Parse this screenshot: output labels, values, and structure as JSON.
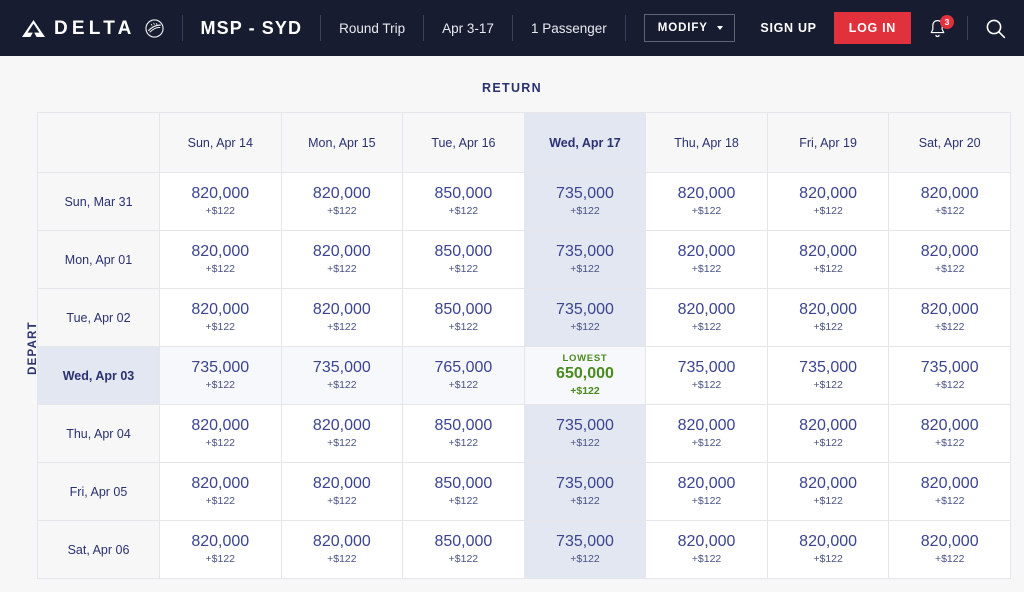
{
  "header": {
    "brand": "DELTA",
    "widget_icon": "delta-widget-icon",
    "skymiles_icon": "skymiles-emblem-icon",
    "route": "MSP - SYD",
    "trip_type": "Round Trip",
    "date_range": "Apr 3-17",
    "passengers": "1 Passenger",
    "modify_label": "MODIFY",
    "sign_up": "SIGN UP",
    "log_in": "LOG IN",
    "notification_count": "3",
    "bell_icon": "bell-icon",
    "search_icon": "search-icon",
    "accent_red": "#e0313d",
    "bar_background": "#171c30"
  },
  "calendar": {
    "return_label": "RETURN",
    "depart_label": "DEPART",
    "selected_return_column": "Wed, Apr 17",
    "selected_depart_row": "Wed, Apr 03",
    "lowest_tag": "LOWEST",
    "highlight_color": "#e3e7f2",
    "lowest_color": "#4a8b1f",
    "miles_color": "#3b4490",
    "return_dates": [
      "Sun, Apr 14",
      "Mon, Apr 15",
      "Tue, Apr 16",
      "Wed, Apr 17",
      "Thu, Apr 18",
      "Fri, Apr 19",
      "Sat, Apr 20"
    ],
    "depart_dates": [
      "Sun, Mar 31",
      "Mon, Apr 01",
      "Tue, Apr 02",
      "Wed, Apr 03",
      "Thu, Apr 04",
      "Fri, Apr 05",
      "Sat, Apr 06"
    ],
    "rows": [
      {
        "depart": "Sun, Mar 31",
        "selected": false,
        "cells": [
          {
            "miles": "820,000",
            "taxes": "+$122",
            "lowest": false
          },
          {
            "miles": "820,000",
            "taxes": "+$122",
            "lowest": false
          },
          {
            "miles": "850,000",
            "taxes": "+$122",
            "lowest": false
          },
          {
            "miles": "735,000",
            "taxes": "+$122",
            "lowest": false
          },
          {
            "miles": "820,000",
            "taxes": "+$122",
            "lowest": false
          },
          {
            "miles": "820,000",
            "taxes": "+$122",
            "lowest": false
          },
          {
            "miles": "820,000",
            "taxes": "+$122",
            "lowest": false
          }
        ]
      },
      {
        "depart": "Mon, Apr 01",
        "selected": false,
        "cells": [
          {
            "miles": "820,000",
            "taxes": "+$122",
            "lowest": false
          },
          {
            "miles": "820,000",
            "taxes": "+$122",
            "lowest": false
          },
          {
            "miles": "850,000",
            "taxes": "+$122",
            "lowest": false
          },
          {
            "miles": "735,000",
            "taxes": "+$122",
            "lowest": false
          },
          {
            "miles": "820,000",
            "taxes": "+$122",
            "lowest": false
          },
          {
            "miles": "820,000",
            "taxes": "+$122",
            "lowest": false
          },
          {
            "miles": "820,000",
            "taxes": "+$122",
            "lowest": false
          }
        ]
      },
      {
        "depart": "Tue, Apr 02",
        "selected": false,
        "cells": [
          {
            "miles": "820,000",
            "taxes": "+$122",
            "lowest": false
          },
          {
            "miles": "820,000",
            "taxes": "+$122",
            "lowest": false
          },
          {
            "miles": "850,000",
            "taxes": "+$122",
            "lowest": false
          },
          {
            "miles": "735,000",
            "taxes": "+$122",
            "lowest": false
          },
          {
            "miles": "820,000",
            "taxes": "+$122",
            "lowest": false
          },
          {
            "miles": "820,000",
            "taxes": "+$122",
            "lowest": false
          },
          {
            "miles": "820,000",
            "taxes": "+$122",
            "lowest": false
          }
        ]
      },
      {
        "depart": "Wed, Apr 03",
        "selected": true,
        "cells": [
          {
            "miles": "735,000",
            "taxes": "+$122",
            "lowest": false
          },
          {
            "miles": "735,000",
            "taxes": "+$122",
            "lowest": false
          },
          {
            "miles": "765,000",
            "taxes": "+$122",
            "lowest": false
          },
          {
            "miles": "650,000",
            "taxes": "+$122",
            "lowest": true
          },
          {
            "miles": "735,000",
            "taxes": "+$122",
            "lowest": false
          },
          {
            "miles": "735,000",
            "taxes": "+$122",
            "lowest": false
          },
          {
            "miles": "735,000",
            "taxes": "+$122",
            "lowest": false
          }
        ]
      },
      {
        "depart": "Thu, Apr 04",
        "selected": false,
        "cells": [
          {
            "miles": "820,000",
            "taxes": "+$122",
            "lowest": false
          },
          {
            "miles": "820,000",
            "taxes": "+$122",
            "lowest": false
          },
          {
            "miles": "850,000",
            "taxes": "+$122",
            "lowest": false
          },
          {
            "miles": "735,000",
            "taxes": "+$122",
            "lowest": false
          },
          {
            "miles": "820,000",
            "taxes": "+$122",
            "lowest": false
          },
          {
            "miles": "820,000",
            "taxes": "+$122",
            "lowest": false
          },
          {
            "miles": "820,000",
            "taxes": "+$122",
            "lowest": false
          }
        ]
      },
      {
        "depart": "Fri, Apr 05",
        "selected": false,
        "cells": [
          {
            "miles": "820,000",
            "taxes": "+$122",
            "lowest": false
          },
          {
            "miles": "820,000",
            "taxes": "+$122",
            "lowest": false
          },
          {
            "miles": "850,000",
            "taxes": "+$122",
            "lowest": false
          },
          {
            "miles": "735,000",
            "taxes": "+$122",
            "lowest": false
          },
          {
            "miles": "820,000",
            "taxes": "+$122",
            "lowest": false
          },
          {
            "miles": "820,000",
            "taxes": "+$122",
            "lowest": false
          },
          {
            "miles": "820,000",
            "taxes": "+$122",
            "lowest": false
          }
        ]
      },
      {
        "depart": "Sat, Apr 06",
        "selected": false,
        "cells": [
          {
            "miles": "820,000",
            "taxes": "+$122",
            "lowest": false
          },
          {
            "miles": "820,000",
            "taxes": "+$122",
            "lowest": false
          },
          {
            "miles": "850,000",
            "taxes": "+$122",
            "lowest": false
          },
          {
            "miles": "735,000",
            "taxes": "+$122",
            "lowest": false
          },
          {
            "miles": "820,000",
            "taxes": "+$122",
            "lowest": false
          },
          {
            "miles": "820,000",
            "taxes": "+$122",
            "lowest": false
          },
          {
            "miles": "820,000",
            "taxes": "+$122",
            "lowest": false
          }
        ]
      }
    ]
  }
}
